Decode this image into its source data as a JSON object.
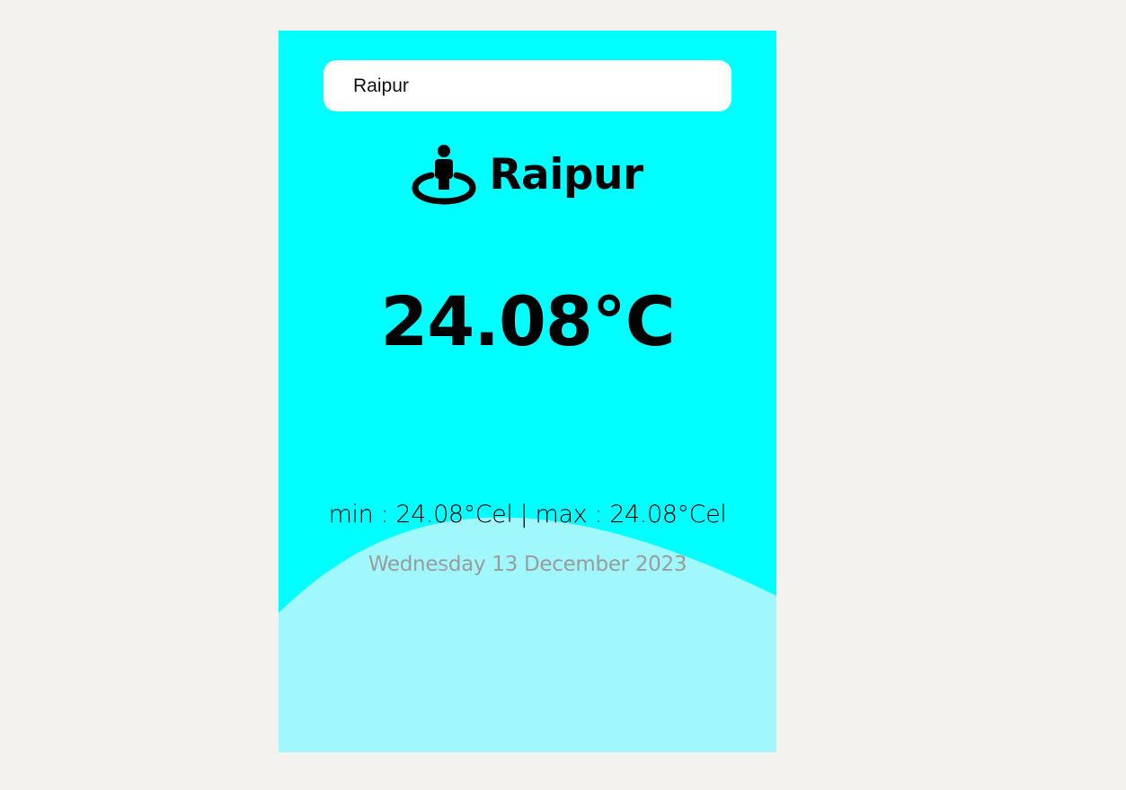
{
  "search": {
    "value": "Raipur",
    "placeholder": ""
  },
  "location": {
    "icon": "person-pin-icon",
    "city": "Raipur"
  },
  "weather": {
    "temperature": "24.08°C",
    "min_max": "min : 24.08°Cel | max : 24.08°Cel",
    "date": "Wednesday 13 December 2023"
  },
  "colors": {
    "background": "#f3f2ee",
    "card": "#00ffff",
    "wave": "#a0f8fc",
    "date_text": "#9b9b9b"
  }
}
